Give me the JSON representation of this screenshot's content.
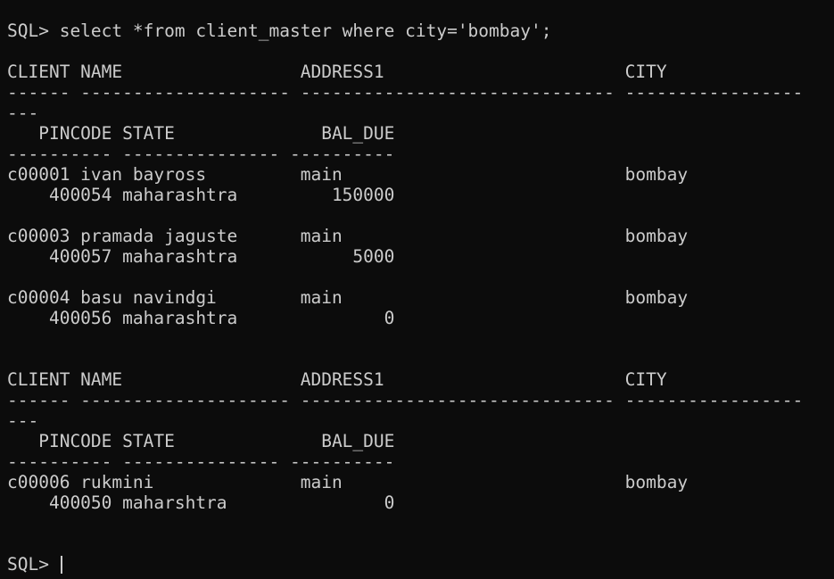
{
  "terminal": {
    "command_line": "SQL> select *from client_master where city='bombay';",
    "block1": {
      "header1": "CLIENT NAME                 ADDRESS1                       CITY",
      "dashes1a": "------ -------------------- ------------------------------ -----------------",
      "dashes1b": "---",
      "header2": "   PINCODE STATE              BAL_DUE",
      "dashes2": "---------- --------------- ----------",
      "rows": [
        {
          "line1": "c00001 ivan bayross         main                           bombay",
          "line2": "    400054 maharashtra         150000"
        },
        {
          "line1": "c00003 pramada jaguste      main                           bombay",
          "line2": "    400057 maharashtra           5000"
        },
        {
          "line1": "c00004 basu navindgi        main                           bombay",
          "line2": "    400056 maharashtra              0"
        }
      ]
    },
    "block2": {
      "header1": "CLIENT NAME                 ADDRESS1                       CITY",
      "dashes1a": "------ -------------------- ------------------------------ -----------------",
      "dashes1b": "---",
      "header2": "   PINCODE STATE              BAL_DUE",
      "dashes2": "---------- --------------- ----------",
      "rows": [
        {
          "line1": "c00006 rukmini              main                           bombay",
          "line2": "    400050 maharshtra               0"
        }
      ]
    },
    "prompt": "SQL> "
  },
  "colors": {
    "background": "#0c0c0c",
    "foreground": "#cccccc"
  }
}
